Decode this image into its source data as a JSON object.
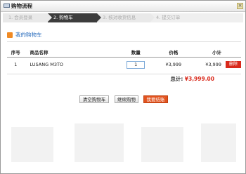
{
  "dialog": {
    "title": "购物流程",
    "close_label": "×"
  },
  "steps": [
    {
      "label": "1. 会员登录"
    },
    {
      "label": "2. 购物车"
    },
    {
      "label": "3. 核对收货信息"
    },
    {
      "label": "4. 提交订单"
    }
  ],
  "cart": {
    "heading": "我的购物车",
    "columns": [
      "序号",
      "商品名称",
      "数量",
      "价格",
      "小计"
    ],
    "rows": [
      {
        "no": "1",
        "name": "LUSANG M3TO",
        "qty": "1",
        "price": "¥3,999",
        "subtotal": "¥3,999",
        "delete_label": "删除"
      }
    ],
    "total_label": "总计:",
    "total_value": "¥3,999.00"
  },
  "buttons": {
    "clear": "清空购物车",
    "continue": "继续购物",
    "checkout": "我要结账"
  },
  "colors": {
    "accent": "#d9291b",
    "link": "#2a6dbd",
    "active_step": "#3c3c3c"
  }
}
